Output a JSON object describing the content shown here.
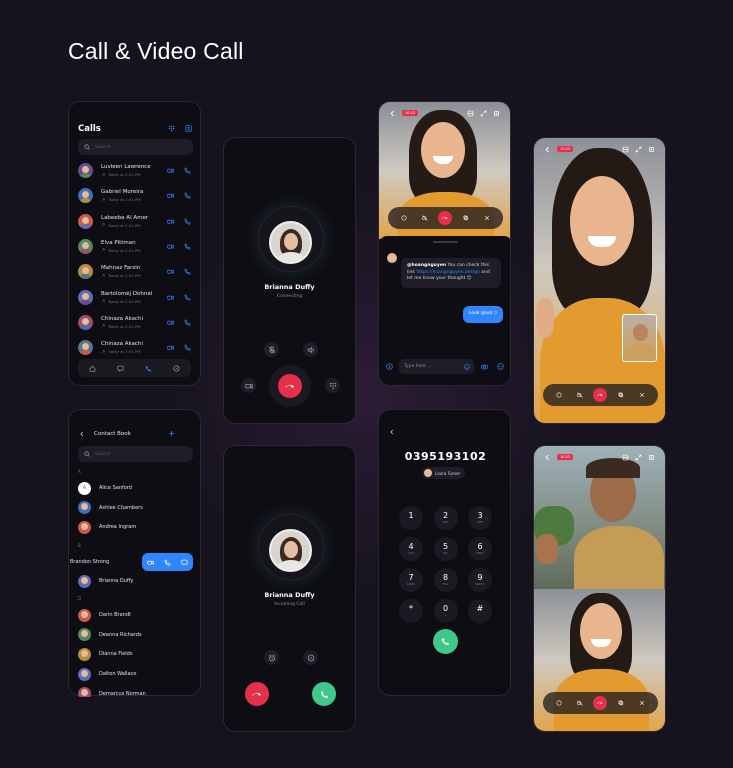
{
  "page_title": "Call & Video Call",
  "calls": {
    "title": "Calls",
    "search_placeholder": "Search",
    "items": [
      {
        "name": "Luvleen Lawrence",
        "time": "Today at 2:41 PM"
      },
      {
        "name": "Gabriel Moreira",
        "time": "Today at 2:41 PM"
      },
      {
        "name": "Labeeba Al Amer",
        "time": "Today at 2:41 PM"
      },
      {
        "name": "Elva Pittman",
        "time": "Today at 2:41 PM"
      },
      {
        "name": "Mahnaz Farzin",
        "time": "Today at 2:41 PM"
      },
      {
        "name": "Bartolomëj Dohnal",
        "time": "Today at 2:41 PM"
      },
      {
        "name": "Chinaza Akachi",
        "time": "Today at 2:41 PM"
      },
      {
        "name": "Chinaza Akachi",
        "time": "Today at 2:41 PM"
      }
    ]
  },
  "connecting": {
    "name": "Brianna Duffy",
    "status": "Connecting"
  },
  "incoming": {
    "name": "Brianna Duffy",
    "status": "Incoming Call"
  },
  "video_chat": {
    "timer": "10:23",
    "incoming_message_handle": "@hoangnguyen",
    "incoming_message_text": " You can check this link ",
    "incoming_message_link": "https://hoangnguyen.design",
    "incoming_message_tail": " and let me know your thought 😊",
    "outgoing_message": "Look good :)",
    "input_placeholder": "Type here ..."
  },
  "video_full": {
    "timer": "10:23"
  },
  "video_group": {
    "timer": "10:23"
  },
  "contacts": {
    "title": "Contact Book",
    "search_placeholder": "Search",
    "sections": {
      "a": "A",
      "b": "B",
      "d": "D"
    },
    "items_a": [
      "Alice Sanford",
      "Ashlee Chambers",
      "Andrea Ingram"
    ],
    "swiped": "Brandon Strong",
    "items_b": [
      "Brianna Duffy"
    ],
    "items_d": [
      "Darin Brandt",
      "Deanna Richards",
      "Dianna Fields",
      "Dalton Wallace",
      "Demarcus Norman"
    ]
  },
  "dialer": {
    "number": "0395193102",
    "contact": "Laura Turner",
    "keys": [
      {
        "d": "1",
        "l": ""
      },
      {
        "d": "2",
        "l": "ABC"
      },
      {
        "d": "3",
        "l": "DEF"
      },
      {
        "d": "4",
        "l": "GHI"
      },
      {
        "d": "5",
        "l": "JKL"
      },
      {
        "d": "6",
        "l": "MNO"
      },
      {
        "d": "7",
        "l": "PQRS"
      },
      {
        "d": "8",
        "l": "TUV"
      },
      {
        "d": "9",
        "l": "WXYZ"
      },
      {
        "d": "*",
        "l": ""
      },
      {
        "d": "0",
        "l": "+"
      },
      {
        "d": "#",
        "l": ""
      }
    ]
  },
  "colors": {
    "accent": "#2f86ff",
    "danger": "#e5304c",
    "success": "#3ec98a",
    "background": "#16131f",
    "card": "#0e0d14"
  },
  "icons": [
    "search-icon",
    "phone-icon",
    "video-icon",
    "chat-icon",
    "home-icon",
    "compass-icon",
    "dialpad-icon",
    "contacts-icon",
    "mic-icon",
    "speaker-icon",
    "end-call-icon",
    "alarm-icon",
    "back-icon",
    "plus-icon",
    "send-icon",
    "emoji-icon",
    "camera-icon",
    "more-icon",
    "flip-icon",
    "expand-icon",
    "copy-icon",
    "close-icon"
  ]
}
